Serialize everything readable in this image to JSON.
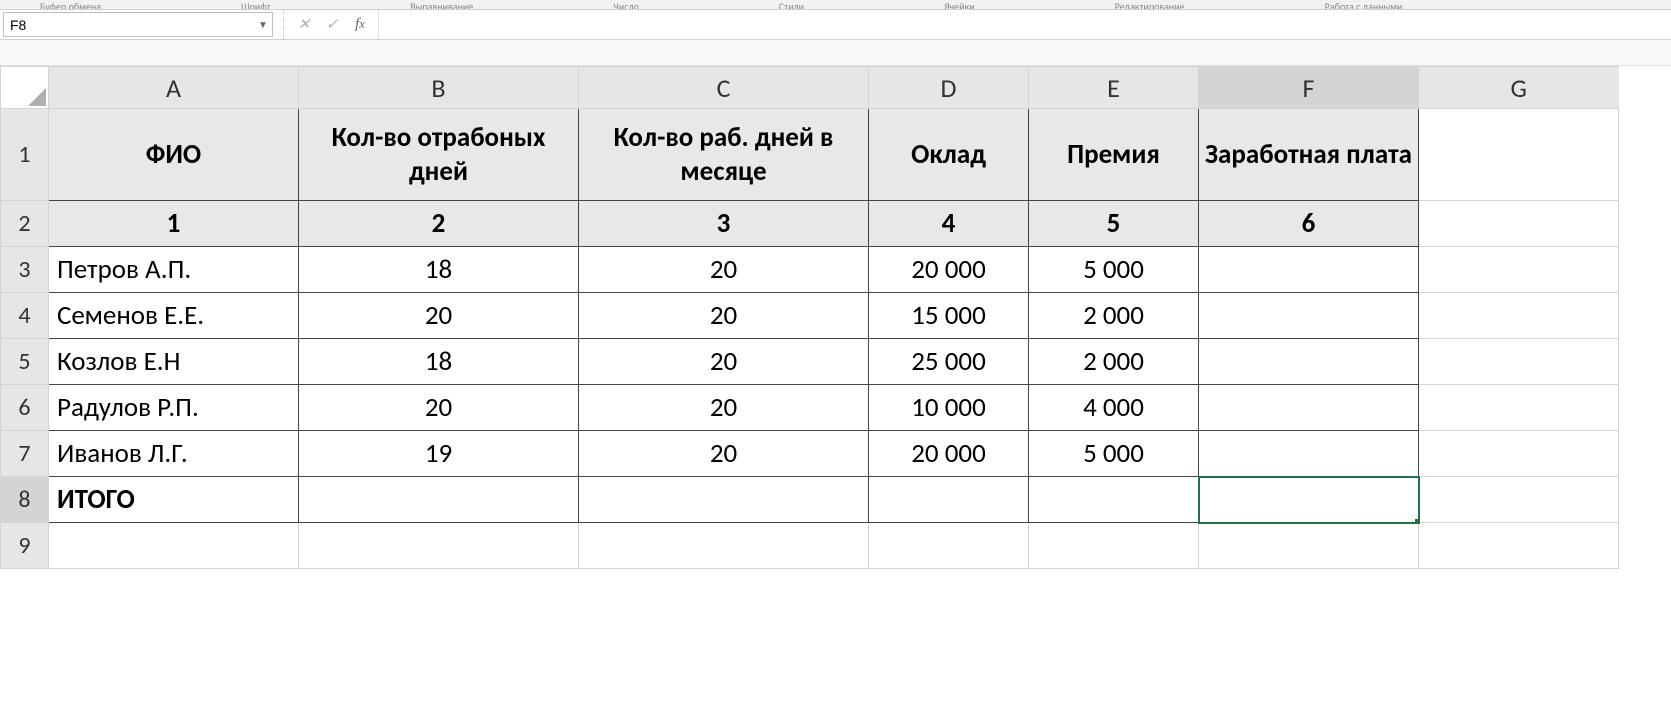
{
  "ribbon_groups": [
    "Буфер обмена",
    "Шрифт",
    "Выравнивание",
    "Число",
    "Стили",
    "Ячейки",
    "Редактирование",
    "Работа с данными"
  ],
  "name_box": "F8",
  "formula": "",
  "columns": [
    "A",
    "B",
    "C",
    "D",
    "E",
    "F",
    "G"
  ],
  "selected_col": "F",
  "selected_row": "8",
  "row_numbers": [
    "1",
    "2",
    "3",
    "4",
    "5",
    "6",
    "7",
    "8",
    "9"
  ],
  "headers": {
    "A": "ФИО",
    "B": "Кол-во отрабоных дней",
    "C": "Кол-во раб. дней в месяце",
    "D": "Оклад",
    "E": "Премия",
    "F": "Заработная плата"
  },
  "col_nums": {
    "A": "1",
    "B": "2",
    "C": "3",
    "D": "4",
    "E": "5",
    "F": "6"
  },
  "rows": [
    {
      "A": "Петров А.П.",
      "B": "18",
      "C": "20",
      "D": "20 000",
      "E": "5 000",
      "F": ""
    },
    {
      "A": "Семенов Е.Е.",
      "B": "20",
      "C": "20",
      "D": "15 000",
      "E": "2 000",
      "F": ""
    },
    {
      "A": "Козлов Е.Н",
      "B": "18",
      "C": "20",
      "D": "25 000",
      "E": "2 000",
      "F": ""
    },
    {
      "A": "Радулов Р.П.",
      "B": "20",
      "C": "20",
      "D": "10 000",
      "E": "4 000",
      "F": ""
    },
    {
      "A": "Иванов Л.Г.",
      "B": "19",
      "C": "20",
      "D": "20 000",
      "E": "5 000",
      "F": ""
    }
  ],
  "total_label": "ИТОГО",
  "chart_data": {
    "type": "table",
    "columns": [
      "ФИО",
      "Кол-во отрабоных дней",
      "Кол-во раб. дней в месяце",
      "Оклад",
      "Премия",
      "Заработная плата"
    ],
    "rows": [
      [
        "Петров А.П.",
        18,
        20,
        20000,
        5000,
        null
      ],
      [
        "Семенов Е.Е.",
        20,
        20,
        15000,
        2000,
        null
      ],
      [
        "Козлов Е.Н",
        18,
        20,
        25000,
        2000,
        null
      ],
      [
        "Радулов Р.П.",
        20,
        20,
        10000,
        4000,
        null
      ],
      [
        "Иванов Л.Г.",
        19,
        20,
        20000,
        5000,
        null
      ]
    ],
    "totals_row": [
      "ИТОГО",
      null,
      null,
      null,
      null,
      null
    ]
  }
}
